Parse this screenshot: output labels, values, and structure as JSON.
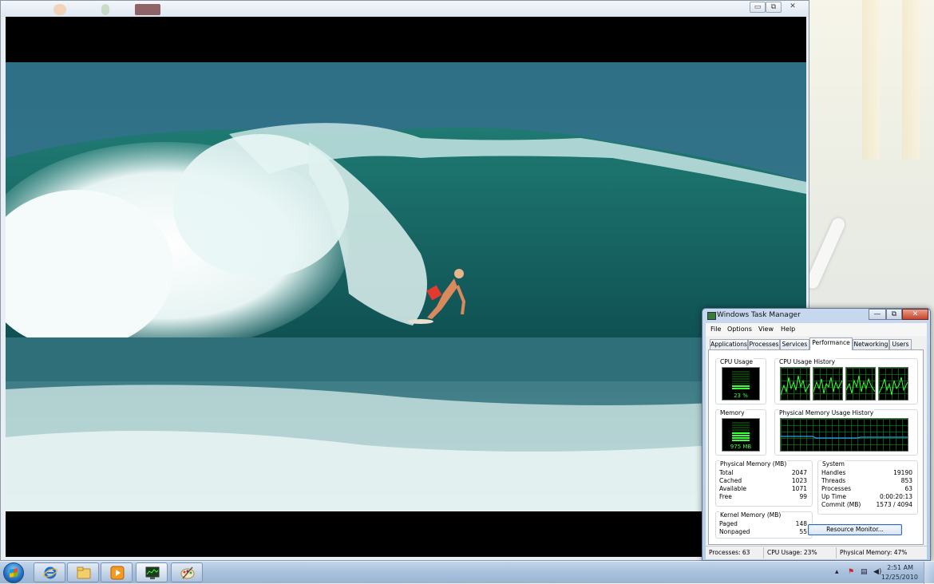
{
  "video_window": {
    "buttons": [
      "▭",
      "⧉",
      "✕"
    ]
  },
  "task_manager": {
    "title": "Windows Task Manager",
    "window_buttons": [
      "—",
      "⧉",
      "✕"
    ],
    "menu": [
      "File",
      "Options",
      "View",
      "Help"
    ],
    "tabs": [
      "Applications",
      "Processes",
      "Services",
      "Performance",
      "Networking",
      "Users"
    ],
    "active_tab": "Performance",
    "cpu_usage": {
      "label": "CPU Usage",
      "value": "23 %",
      "percent": 23
    },
    "cpu_history_label": "CPU Usage History",
    "memory": {
      "label": "Memory",
      "value": "975 MB",
      "percent": 47
    },
    "memory_history_label": "Physical Memory Usage History",
    "physical_memory": {
      "label": "Physical Memory (MB)",
      "rows": [
        {
          "k": "Total",
          "v": "2047"
        },
        {
          "k": "Cached",
          "v": "1023"
        },
        {
          "k": "Available",
          "v": "1071"
        },
        {
          "k": "Free",
          "v": "99"
        }
      ]
    },
    "kernel_memory": {
      "label": "Kernel Memory (MB)",
      "rows": [
        {
          "k": "Paged",
          "v": "148"
        },
        {
          "k": "Nonpaged",
          "v": "55"
        }
      ]
    },
    "system": {
      "label": "System",
      "rows": [
        {
          "k": "Handles",
          "v": "19190"
        },
        {
          "k": "Threads",
          "v": "853"
        },
        {
          "k": "Processes",
          "v": "63"
        },
        {
          "k": "Up Time",
          "v": "0:00:20:13"
        },
        {
          "k": "Commit (MB)",
          "v": "1573 / 4094"
        }
      ]
    },
    "resource_monitor_button": "Resource Monitor...",
    "status": {
      "processes": "Processes: 63",
      "cpu": "CPU Usage: 23%",
      "memory": "Physical Memory: 47%"
    }
  },
  "taskbar": {
    "pinned": [
      "internet-explorer-icon",
      "windows-explorer-icon",
      "media-player-icon",
      "task-manager-icon",
      "paint-icon"
    ],
    "tray_icons": [
      "show-hidden-icons-icon",
      "action-center-icon",
      "network-icon",
      "volume-icon"
    ],
    "clock_time": "2:51 AM",
    "clock_date": "12/25/2010"
  },
  "colors": {
    "graph_green": "#3bff3b",
    "memory_line": "#2aa0ff",
    "taskbar": "#a8c0dc"
  }
}
